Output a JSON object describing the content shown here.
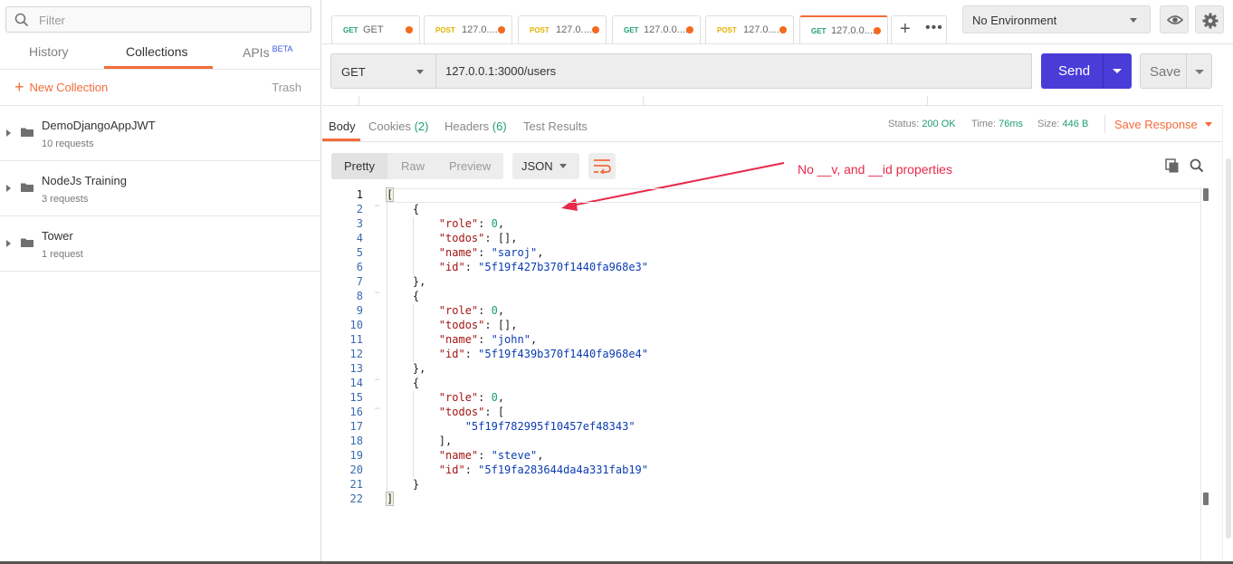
{
  "sidebar": {
    "filter_placeholder": "Filter",
    "tabs": [
      {
        "label": "History"
      },
      {
        "label": "Collections"
      },
      {
        "label": "APIs",
        "badge": "BETA"
      }
    ],
    "new_collection": "New Collection",
    "trash": "Trash",
    "collections": [
      {
        "name": "DemoDjangoAppJWT",
        "count": "10 requests"
      },
      {
        "name": "NodeJs Training",
        "count": "3 requests"
      },
      {
        "name": "Tower",
        "count": "1 request"
      }
    ]
  },
  "tabs": [
    {
      "method": "GET",
      "title": "GET"
    },
    {
      "method": "POST",
      "title": "127.0...."
    },
    {
      "method": "POST",
      "title": "127.0...."
    },
    {
      "method": "GET",
      "title": "127.0.0...."
    },
    {
      "method": "POST",
      "title": "127.0...."
    },
    {
      "method": "GET",
      "title": "127.0.0...."
    }
  ],
  "environment": "No Environment",
  "request": {
    "method": "GET",
    "url": "127.0.0.1:3000/users",
    "send": "Send",
    "save": "Save"
  },
  "response": {
    "tabs": {
      "body": "Body",
      "cookies": "Cookies",
      "cookies_count": "(2)",
      "headers": "Headers",
      "headers_count": "(6)",
      "tests": "Test Results"
    },
    "status_label": "Status:",
    "status": "200 OK",
    "time_label": "Time:",
    "time": "76ms",
    "size_label": "Size:",
    "size": "446 B",
    "save_response": "Save Response",
    "format": {
      "pretty": "Pretty",
      "raw": "Raw",
      "preview": "Preview",
      "type": "JSON"
    }
  },
  "annotation": "No __v, and __id properties",
  "code_lines": [
    {
      "n": "1",
      "text": "["
    },
    {
      "n": "2",
      "text": "    {"
    },
    {
      "n": "3",
      "text": "        \"role\": 0,"
    },
    {
      "n": "4",
      "text": "        \"todos\": [],"
    },
    {
      "n": "5",
      "text": "        \"name\": \"saroj\","
    },
    {
      "n": "6",
      "text": "        \"id\": \"5f19f427b370f1440fa968e3\""
    },
    {
      "n": "7",
      "text": "    },"
    },
    {
      "n": "8",
      "text": "    {"
    },
    {
      "n": "9",
      "text": "        \"role\": 0,"
    },
    {
      "n": "10",
      "text": "        \"todos\": [],"
    },
    {
      "n": "11",
      "text": "        \"name\": \"john\","
    },
    {
      "n": "12",
      "text": "        \"id\": \"5f19f439b370f1440fa968e4\""
    },
    {
      "n": "13",
      "text": "    },"
    },
    {
      "n": "14",
      "text": "    {"
    },
    {
      "n": "15",
      "text": "        \"role\": 0,"
    },
    {
      "n": "16",
      "text": "        \"todos\": ["
    },
    {
      "n": "17",
      "text": "            \"5f19f782995f10457ef48343\""
    },
    {
      "n": "18",
      "text": "        ],"
    },
    {
      "n": "19",
      "text": "        \"name\": \"steve\","
    },
    {
      "n": "20",
      "text": "        \"id\": \"5f19fa283644da4a331fab19\""
    },
    {
      "n": "21",
      "text": "    }"
    },
    {
      "n": "22",
      "text": "]"
    }
  ],
  "colors": {
    "accent": "#f26b3a",
    "send": "#4a3cd7",
    "get": "#1f9e6f",
    "post": "#e3b100",
    "annotation": "#e8294a"
  },
  "icons": [
    "search-icon",
    "folder-icon",
    "plus-icon",
    "eye-icon",
    "gear-icon",
    "wrap-icon",
    "copy-icon"
  ]
}
